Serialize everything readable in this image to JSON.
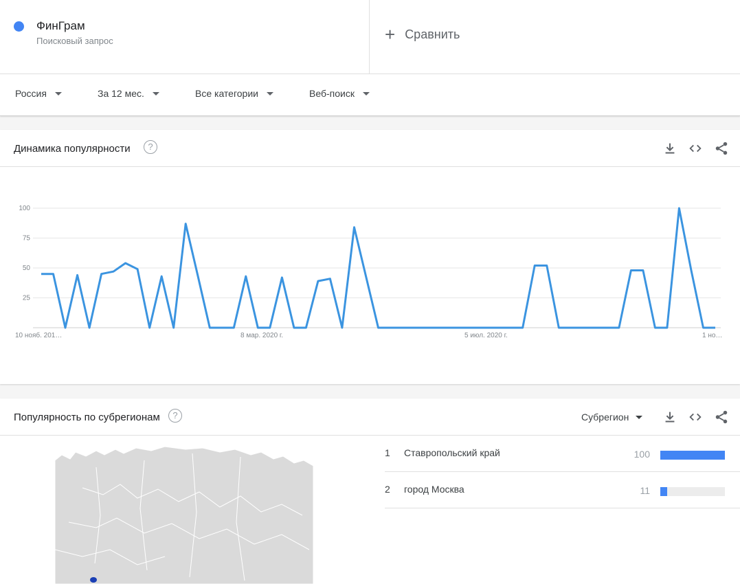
{
  "term": {
    "name": "ФинГрам",
    "subtitle": "Поисковый запрос",
    "color": "#4285f4"
  },
  "compare": {
    "icon": "plus-icon",
    "label": "Сравнить"
  },
  "filters": [
    {
      "label": "Россия"
    },
    {
      "label": "За 12 мес."
    },
    {
      "label": "Все категории"
    },
    {
      "label": "Веб-поиск"
    }
  ],
  "interest_over_time": {
    "title": "Динамика популярности",
    "help": "?",
    "tools": [
      "download-icon",
      "embed-icon",
      "share-icon"
    ]
  },
  "chart_data": {
    "type": "line",
    "x_tick_labels": [
      "10 нояб. 201…",
      "8 мар. 2020 г.",
      "5 июл. 2020 г.",
      "1 но…"
    ],
    "y_ticks": [
      25,
      50,
      75,
      100
    ],
    "ylim": [
      0,
      100
    ],
    "grid": true,
    "line_color": "#3b94e0",
    "series": [
      {
        "values": [
          45,
          45,
          0,
          44,
          0,
          45,
          47,
          54,
          49,
          0,
          43,
          0,
          87,
          44,
          0,
          0,
          0,
          43,
          0,
          0,
          42,
          0,
          0,
          39,
          41,
          0,
          84,
          42,
          0,
          0,
          0,
          0,
          0,
          0,
          0,
          0,
          0,
          0,
          0,
          0,
          0,
          52,
          52,
          0,
          0,
          0,
          0,
          0,
          0,
          48,
          48,
          0,
          0,
          100,
          48,
          0,
          0
        ]
      }
    ]
  },
  "subregion": {
    "title": "Популярность по субрегионам",
    "help": "?",
    "selector": "Субрегион",
    "tools": [
      "download-icon",
      "embed-icon",
      "share-icon"
    ],
    "map_highlight_color": "#1a3fb5",
    "rows": [
      {
        "rank": "1",
        "name": "Ставропольский край",
        "value": "100",
        "fraction": 1.0
      },
      {
        "rank": "2",
        "name": "город Москва",
        "value": "11",
        "fraction": 0.11
      }
    ],
    "bar_color": "#4285f4"
  }
}
